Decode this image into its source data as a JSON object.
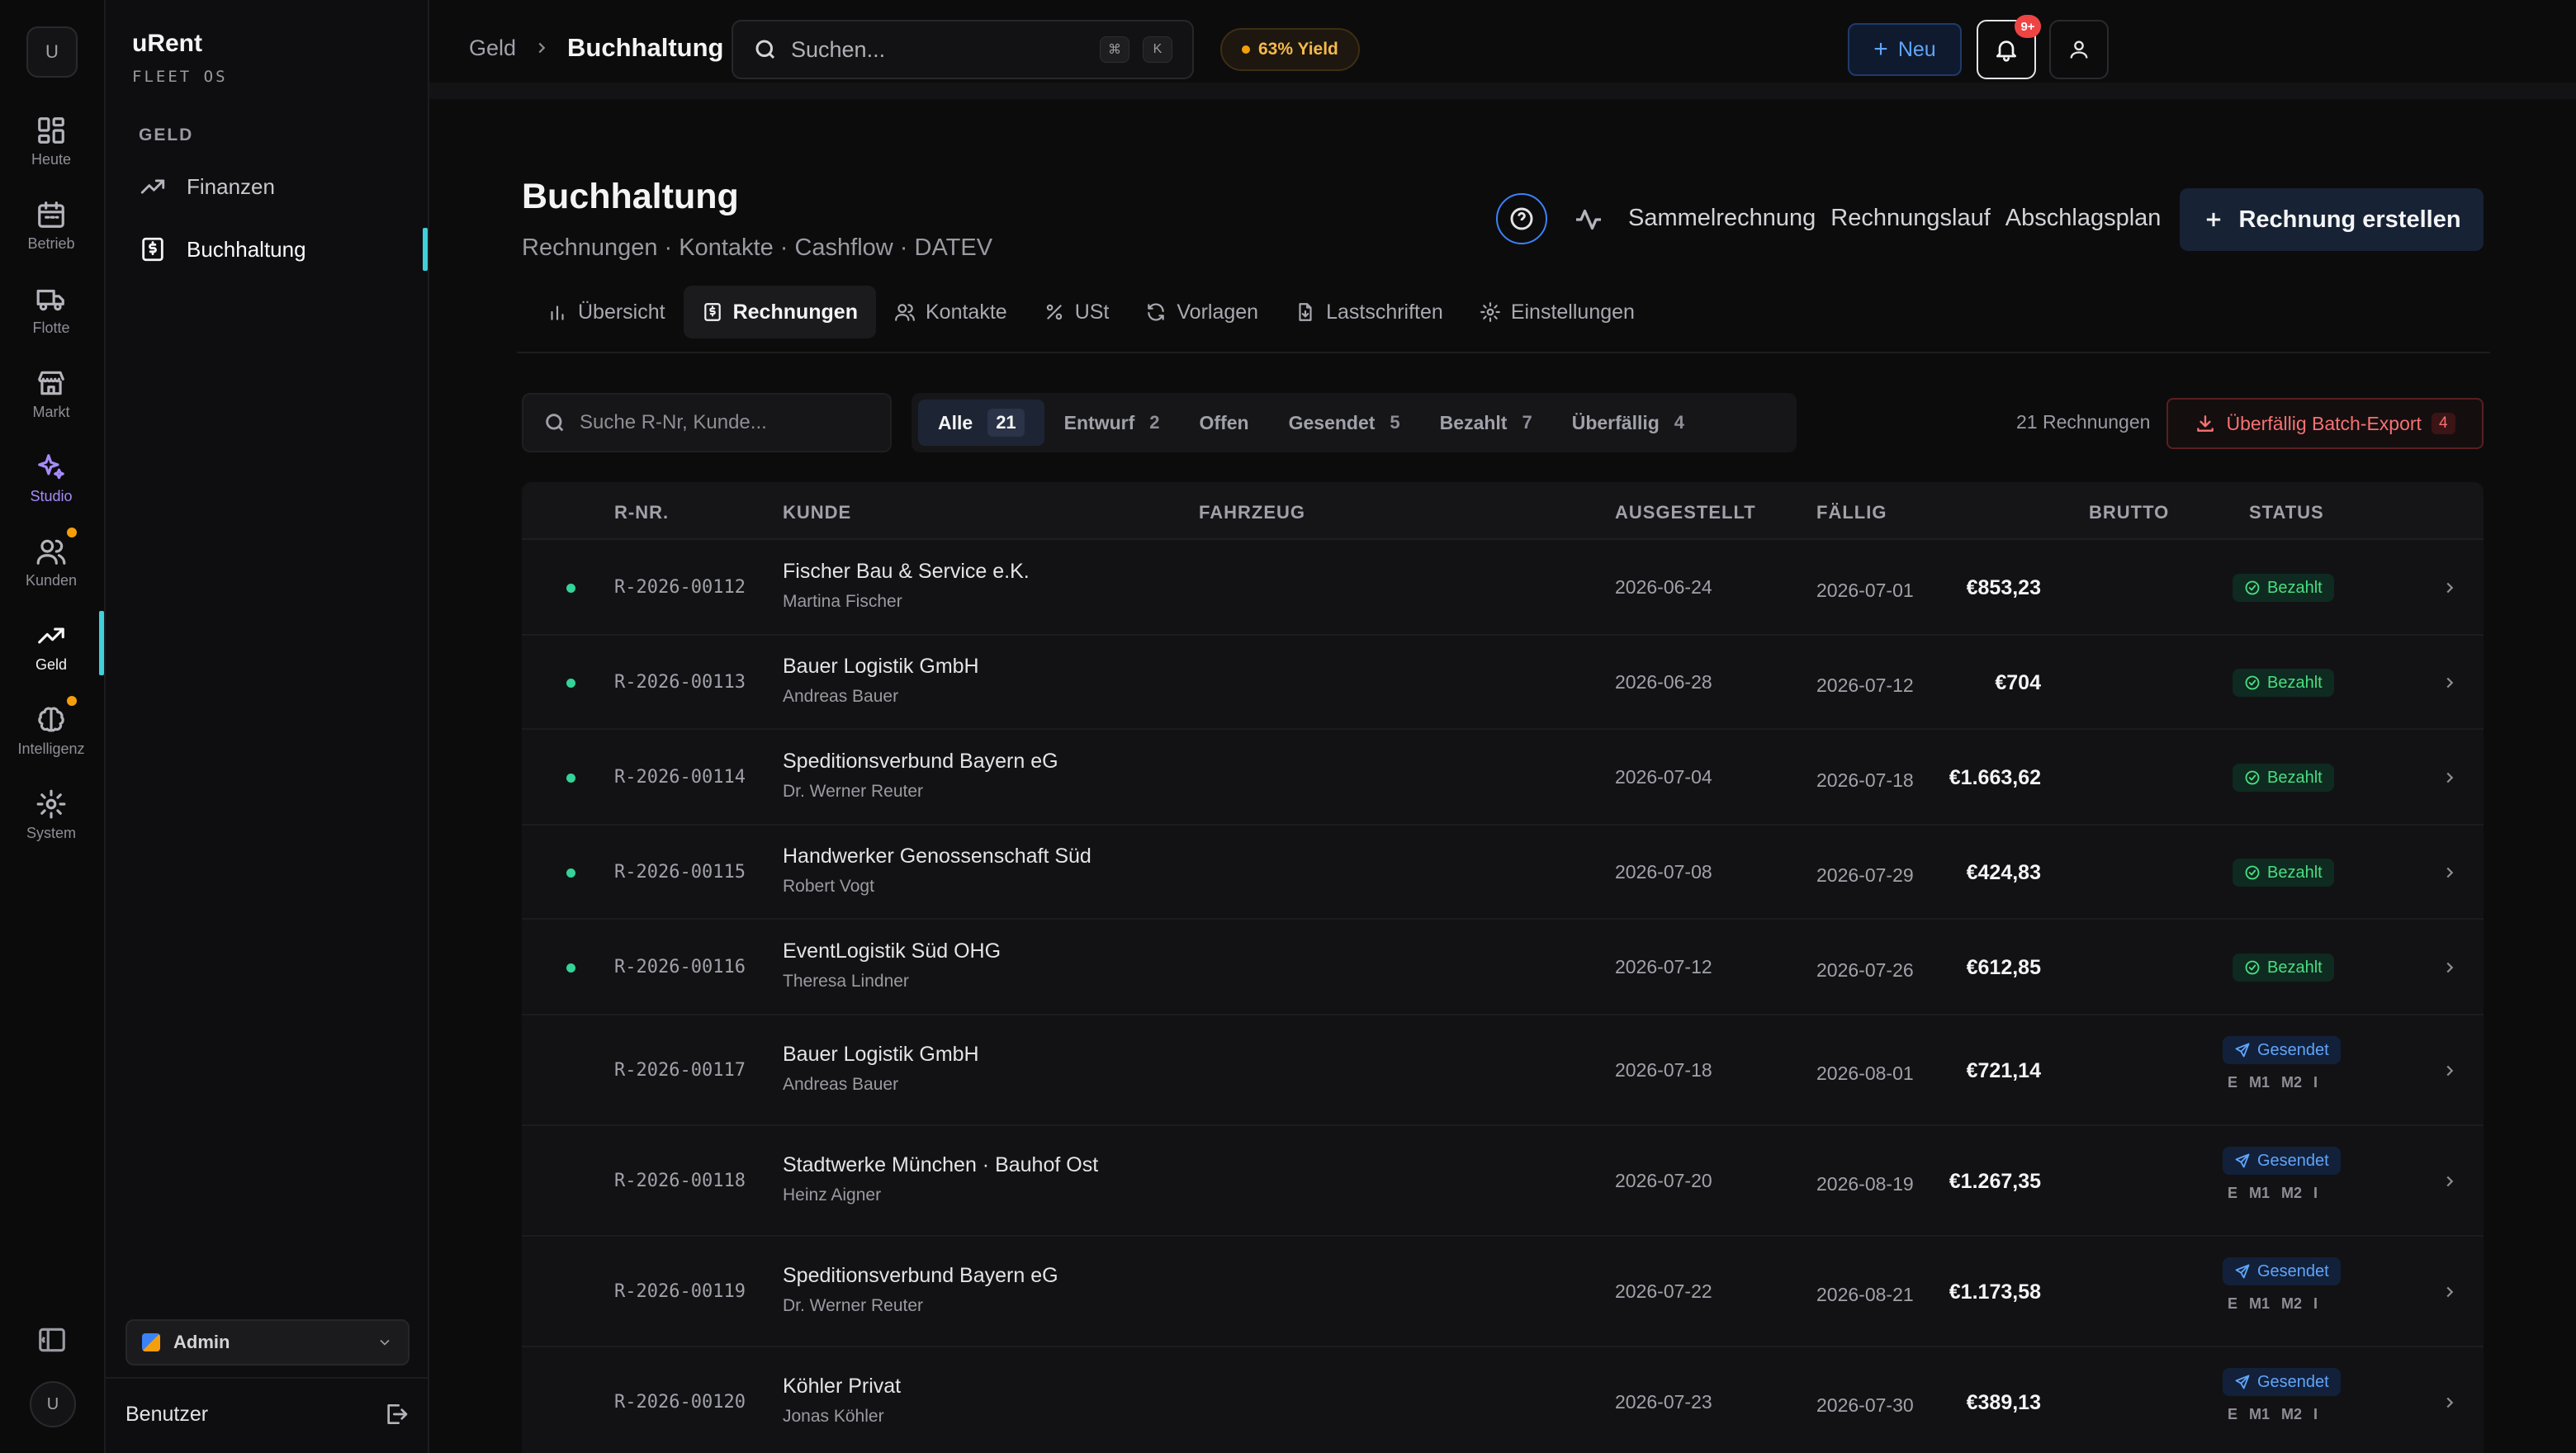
{
  "rail": {
    "avatar": "U",
    "items": [
      {
        "label": "Heute",
        "icon": "dashboard-icon"
      },
      {
        "label": "Betrieb",
        "icon": "calendar-icon"
      },
      {
        "label": "Flotte",
        "icon": "truck-icon"
      },
      {
        "label": "Markt",
        "icon": "store-icon"
      },
      {
        "label": "Studio",
        "icon": "sparkles-icon"
      },
      {
        "label": "Kunden",
        "icon": "users-icon"
      },
      {
        "label": "Geld",
        "icon": "trending-up-icon"
      },
      {
        "label": "Intelligenz",
        "icon": "brain-icon"
      },
      {
        "label": "System",
        "icon": "gear-icon"
      }
    ],
    "user_initial": "U"
  },
  "sidebar": {
    "brand": "uRent",
    "brand_sub": "FLEET OS",
    "section": "GELD",
    "items": [
      {
        "label": "Finanzen"
      },
      {
        "label": "Buchhaltung"
      }
    ],
    "role": "Admin",
    "user": "Benutzer"
  },
  "topbar": {
    "breadcrumb_parent": "Geld",
    "breadcrumb_current": "Buchhaltung",
    "search_placeholder": "Suchen...",
    "kbd_1": "⌘",
    "kbd_2": "K",
    "yield": "63% Yield",
    "new_label": "Neu",
    "notif_badge": "9+"
  },
  "header": {
    "title": "Buchhaltung",
    "subtitle": "Rechnungen · Kontakte · Cashflow · DATEV",
    "actions": [
      "Sammelrechnung",
      "Rechnungslauf",
      "Abschlagsplan"
    ],
    "create_label": "Rechnung erstellen"
  },
  "tabs": [
    {
      "label": "Übersicht"
    },
    {
      "label": "Rechnungen"
    },
    {
      "label": "Kontakte"
    },
    {
      "label": "USt"
    },
    {
      "label": "Vorlagen"
    },
    {
      "label": "Lastschriften"
    },
    {
      "label": "Einstellungen"
    }
  ],
  "filters": {
    "search_placeholder": "Suche R-Nr, Kunde...",
    "segments": [
      {
        "label": "Alle",
        "count": "21"
      },
      {
        "label": "Entwurf",
        "count": "2"
      },
      {
        "label": "Offen",
        "count": ""
      },
      {
        "label": "Gesendet",
        "count": "5"
      },
      {
        "label": "Bezahlt",
        "count": "7"
      },
      {
        "label": "Überfällig",
        "count": "4"
      }
    ],
    "count_text": "21 Rechnungen",
    "batch_label": "Überfällig Batch-Export",
    "batch_count": "4"
  },
  "table": {
    "headers": {
      "rnr": "R-NR.",
      "kunde": "KUNDE",
      "fahrzeug": "FAHRZEUG",
      "ausgestellt": "AUSGESTELLT",
      "faellig": "FÄLLIG",
      "brutto": "BRUTTO",
      "status": "STATUS"
    },
    "stage_labels": [
      "E",
      "M1",
      "M2",
      "I"
    ],
    "rows": [
      {
        "rnr": "R-2026-00112",
        "kunde": "Fischer Bau & Service e.K.",
        "kontakt": "Martina Fischer",
        "ausgestellt": "2026-06-24",
        "faellig": "2026-07-01",
        "brutto": "€853,23",
        "status": "Bezahlt"
      },
      {
        "rnr": "R-2026-00113",
        "kunde": "Bauer Logistik GmbH",
        "kontakt": "Andreas Bauer",
        "ausgestellt": "2026-06-28",
        "faellig": "2026-07-12",
        "brutto": "€704",
        "status": "Bezahlt"
      },
      {
        "rnr": "R-2026-00114",
        "kunde": "Speditionsverbund Bayern eG",
        "kontakt": "Dr. Werner Reuter",
        "ausgestellt": "2026-07-04",
        "faellig": "2026-07-18",
        "brutto": "€1.663,62",
        "status": "Bezahlt"
      },
      {
        "rnr": "R-2026-00115",
        "kunde": "Handwerker Genossenschaft Süd",
        "kontakt": "Robert Vogt",
        "ausgestellt": "2026-07-08",
        "faellig": "2026-07-29",
        "brutto": "€424,83",
        "status": "Bezahlt"
      },
      {
        "rnr": "R-2026-00116",
        "kunde": "EventLogistik Süd OHG",
        "kontakt": "Theresa Lindner",
        "ausgestellt": "2026-07-12",
        "faellig": "2026-07-26",
        "brutto": "€612,85",
        "status": "Bezahlt"
      },
      {
        "rnr": "R-2026-00117",
        "kunde": "Bauer Logistik GmbH",
        "kontakt": "Andreas Bauer",
        "ausgestellt": "2026-07-18",
        "faellig": "2026-08-01",
        "brutto": "€721,14",
        "status": "Gesendet"
      },
      {
        "rnr": "R-2026-00118",
        "kunde": "Stadtwerke München · Bauhof Ost",
        "kontakt": "Heinz Aigner",
        "ausgestellt": "2026-07-20",
        "faellig": "2026-08-19",
        "brutto": "€1.267,35",
        "status": "Gesendet"
      },
      {
        "rnr": "R-2026-00119",
        "kunde": "Speditionsverbund Bayern eG",
        "kontakt": "Dr. Werner Reuter",
        "ausgestellt": "2026-07-22",
        "faellig": "2026-08-21",
        "brutto": "€1.173,58",
        "status": "Gesendet"
      },
      {
        "rnr": "R-2026-00120",
        "kunde": "Köhler Privat",
        "kontakt": "Jonas Köhler",
        "ausgestellt": "2026-07-23",
        "faellig": "2026-07-30",
        "brutto": "€389,13",
        "status": "Gesendet"
      }
    ]
  }
}
